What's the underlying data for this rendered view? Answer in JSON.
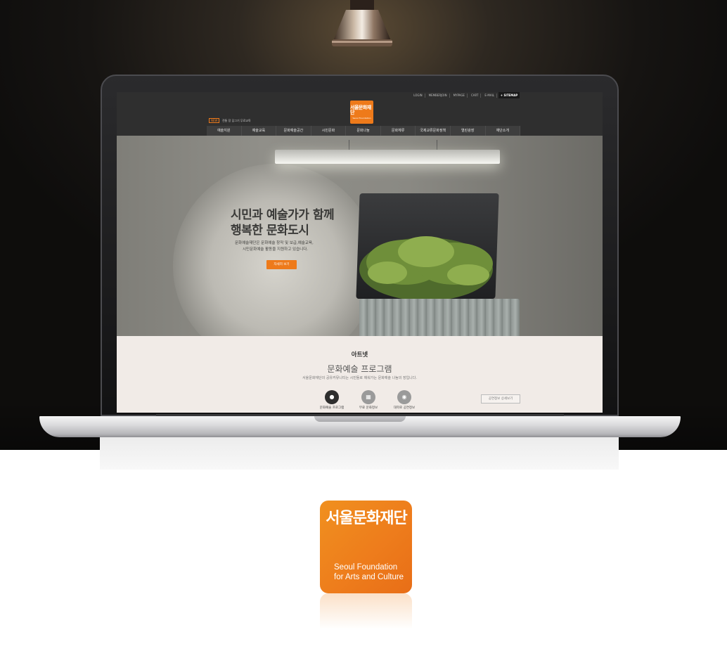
{
  "colors": {
    "brand_orange": "#ee7a1a",
    "header_dark": "#2f2f2f",
    "program_bg": "#f1ebe7"
  },
  "site": {
    "util_links": [
      "LOGIN",
      "MEMBERJOIN",
      "MYPAGE",
      "CART",
      "E-MAIL"
    ],
    "sitemap_label": "+ SITEMAP",
    "news": {
      "badge": "NEW",
      "text": "전통 장 담그기 무료교육"
    },
    "gnb": [
      "예술지원",
      "예술교육",
      "문화예술공간",
      "시민문화",
      "문화나눔",
      "문화체류",
      "국제교류문화정책",
      "열린광장",
      "재단소개"
    ],
    "hero": {
      "title_line_1": "시민과 예술가가 함께",
      "title_line_2": "행복한 문화도시",
      "desc_line_1": "문화예술재단은 문화예술 창작 및 보급,예술교육,",
      "desc_line_2": "시민문화예술 활동을 지원하고 있습니다.",
      "button_label": "자세히 보기"
    },
    "program": {
      "kicker": "아트넷",
      "title": "문화예술 프로그램",
      "desc": "서울문화재단의 공유커뮤니티는 시민들로 채워가는 문화예술 나눔의 장입니다.",
      "items": [
        {
          "label": "문화예술 프로그램",
          "icon": "chat-icon"
        },
        {
          "label": "무료 문화정보",
          "icon": "calendar-icon"
        },
        {
          "label": "대학로 공연정보",
          "icon": "camera-icon"
        }
      ],
      "more_label": "공연정보 상세보기"
    }
  },
  "brand": {
    "logotype": "서울문화재단",
    "en_line_1": "Seoul Foundation",
    "en_line_2": "for Arts and Culture"
  }
}
